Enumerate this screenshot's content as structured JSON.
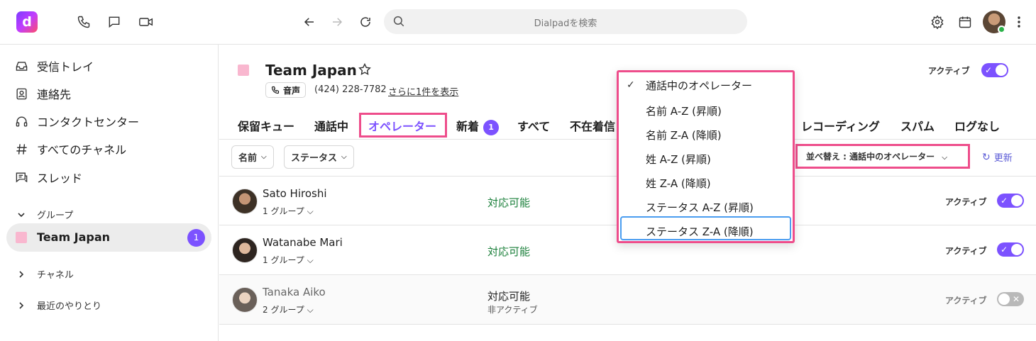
{
  "topbar": {
    "logo_letter": "d",
    "search_placeholder": "Dialpadを検索",
    "icons": [
      "phone-icon",
      "chat-icon",
      "video-icon",
      "back-arrow-icon",
      "forward-arrow-icon",
      "reload-icon",
      "search-icon",
      "gear-icon",
      "calendar-icon",
      "kebab-menu-icon"
    ]
  },
  "sidebar": {
    "items": [
      {
        "label": "受信トレイ",
        "icon": "inbox-icon"
      },
      {
        "label": "連絡先",
        "icon": "contacts-icon"
      },
      {
        "label": "コンタクトセンター",
        "icon": "headset-icon"
      },
      {
        "label": "すべてのチャネル",
        "icon": "hash-icon"
      },
      {
        "label": "スレッド",
        "icon": "thread-icon"
      }
    ],
    "groups_header": "グループ",
    "team": {
      "label": "Team Japan",
      "badge": "1"
    },
    "channels_header": "チャネル",
    "recent_header": "最近のやりとり"
  },
  "header": {
    "title": "Team Japan",
    "phone_chip": "音声",
    "phone_number": "(424) 228-7782",
    "more_link": "さらに1件を表示",
    "active_label": "アクティブ",
    "active_on": true
  },
  "tabs": [
    {
      "label": "保留キュー"
    },
    {
      "label": "通話中"
    },
    {
      "label": "オペレーター",
      "selected": true
    },
    {
      "label": "新着",
      "badge": "1"
    },
    {
      "label": "すべて"
    },
    {
      "label": "不在着信"
    },
    {
      "label": "レコーディング"
    },
    {
      "label": "スパム"
    },
    {
      "label": "ログなし"
    }
  ],
  "filters": {
    "name": "名前",
    "status": "ステータス",
    "sort_label": "並べ替え : 通話中のオペレーター",
    "refresh": "更新"
  },
  "operators": [
    {
      "name": "Sato Hiroshi",
      "groups": "1 グループ",
      "status": "対応可能",
      "sub": "",
      "active_label": "アクティブ",
      "active": true
    },
    {
      "name": "Watanabe Mari",
      "groups": "1 グループ",
      "status": "対応可能",
      "sub": "",
      "active_label": "アクティブ",
      "active": true
    },
    {
      "name": "Tanaka Aiko",
      "groups": "2 グループ",
      "status": "対応可能",
      "sub": "非アクティブ",
      "active_label": "アクティブ",
      "active": false
    }
  ],
  "sort_menu": {
    "options": [
      {
        "label": "通話中のオペレーター",
        "checked": true
      },
      {
        "label": "名前 A-Z (昇順)"
      },
      {
        "label": "名前 Z-A (降順)"
      },
      {
        "label": "姓 A-Z (昇順)"
      },
      {
        "label": "姓 Z-A (降順)"
      },
      {
        "label": "ステータス A-Z (昇順)"
      },
      {
        "label": "ステータス Z-A (降順)",
        "hovered": true
      }
    ]
  },
  "colors": {
    "accent": "#7c52ff",
    "highlight_box": "#ee4d8b",
    "available_green": "#1a7f3a",
    "team_square": "#f9b7cf"
  }
}
